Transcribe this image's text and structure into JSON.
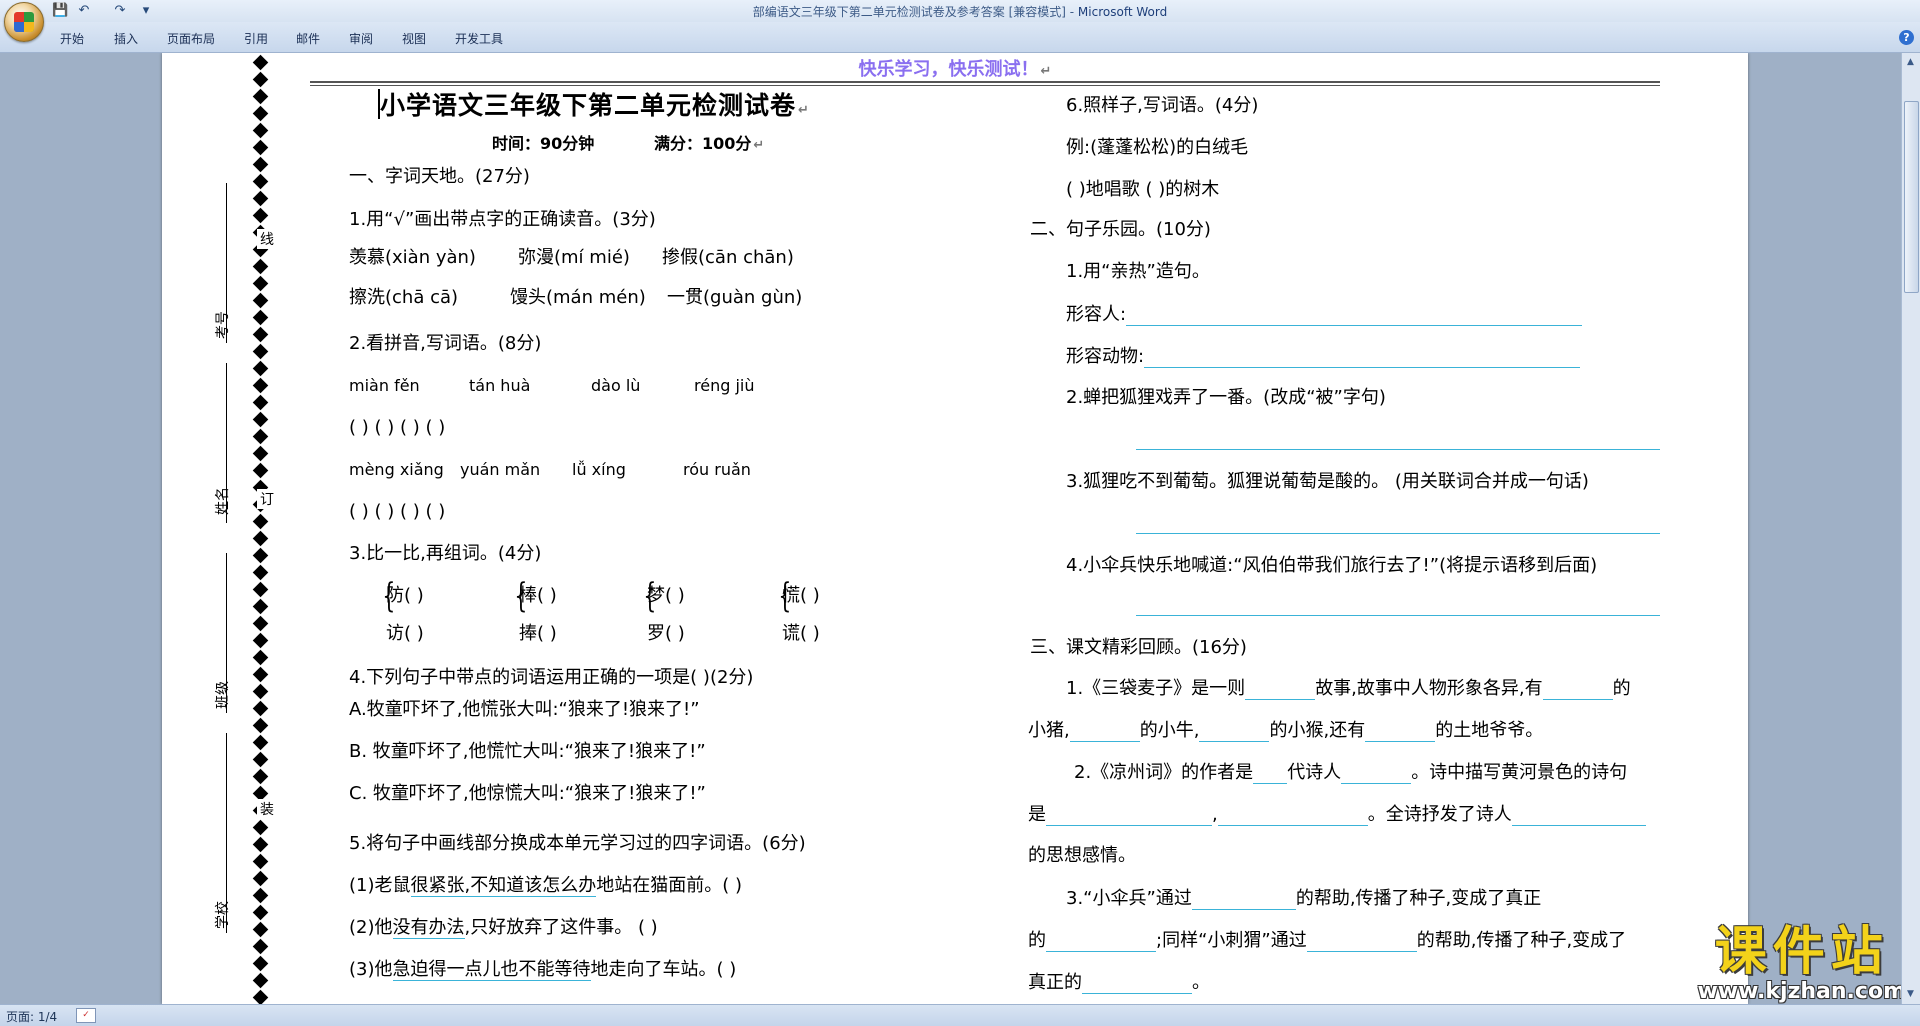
{
  "window": {
    "title_doc": "部编语文三年级下第二单元检测试卷及参考答案 [兼容模式] - ",
    "title_app": "Microsoft Word"
  },
  "ribbon": {
    "tabs": [
      "开始",
      "插入",
      "页面布局",
      "引用",
      "邮件",
      "审阅",
      "视图",
      "开发工具"
    ]
  },
  "status": {
    "page": "页面: 1/4"
  },
  "doc": {
    "header": "快乐学习，快乐测试！",
    "title": "小学语文三年级下第二单元检测试卷",
    "time": "时间：90分钟",
    "score": "满分：100分",
    "sidebar": {
      "kaohao": "考号",
      "xingming": "姓名",
      "banji": "班级",
      "xuexiao": "学校",
      "xian": "线",
      "ding": "订",
      "zhuang": "装"
    },
    "left": {
      "s1": "一、字词天地。(27分)",
      "q1": "1.用“√”画出带点字的正确读音。(3分)",
      "q1_a1": "羡慕(xiàn  yàn)",
      "q1_a2": "弥漫(mí  mié)",
      "q1_a3": "掺假(cān  chān)",
      "q1_b1": "擦洗(chā  cā)",
      "q1_b2": "馒头(mán  mén)",
      "q1_b3": "一贯(guàn  gùn)",
      "q2": "2.看拼音,写词语。(8分)",
      "q2_p1": "miàn fěn",
      "q2_p2": "tán huà",
      "q2_p3": "dào lù",
      "q2_p4": "réng  jiù",
      "q2_p5": "mèng xiǎng",
      "q2_p6": "yuán mǎn",
      "q2_p7": "lǚ  xíng",
      "q2_p8": "róu ruǎn",
      "paren_row": "(           )    (           )    (           )    (           )",
      "paren_row2": "(           )    (           )    (           )   (           )",
      "q3": "3.比一比,再组词。(4分)",
      "q3_w": [
        "防(      )",
        "访(      )",
        "棒(      )",
        "捧(      )",
        "梦(      )",
        "罗(      )",
        "慌(      )",
        "谎(      )"
      ],
      "q4": "4.下列句子中带点的词语运用正确的一项是(      )(2分)",
      "q4_a": "A.牧童吓坏了,他慌张大叫:“狼来了!狼来了!”",
      "q4_b": "B. 牧童吓坏了,他慌忙大叫:“狼来了!狼来了!”",
      "q4_c": "C. 牧童吓坏了,他惊慌大叫:“狼来了!狼来了!”",
      "q5": "5.将句子中画线部分换成本单元学习过的四字词语。(6分)",
      "q5_1a": "(1)老鼠",
      "q5_1u": "很紧张,不知道该怎么办",
      "q5_1b": "地站在猫面前。(                  )",
      "q5_2a": "(2)他",
      "q5_2u": "没有办法",
      "q5_2b": ",只好放弃了这件事。 (                 )",
      "q5_3a": "(3)他",
      "q5_3u": "急迫得一点儿也不能等待",
      "q5_3b": "地走向了车站。(                  )"
    },
    "right": {
      "q6": "6.照样子,写词语。(4分)",
      "q6_ex": "例:(蓬蓬松松)的白绒毛",
      "q6_a": "(             )地唱歌    (             )的树木",
      "s2": "二、句子乐园。(10分)",
      "r1": "1.用“亲热”造句。",
      "r1_a": "形容人:",
      "r1_b": "形容动物:",
      "r2": "2.蝉把狐狸戏弄了一番。(改成“被”字句)",
      "r3": "3.狐狸吃不到葡萄。狐狸说葡萄是酸的。   (用关联词合并成一句话)",
      "r4": "4.小伞兵快乐地喊道:“风伯伯带我们旅行去了!”(将提示语移到后面)",
      "s3": "三、课文精彩回顾。(16分)",
      "k1_a": "1.《三袋麦子》是一则",
      "k1_b": "故事,故事中人物形象各异,有",
      "k1_c": "的",
      "k1_d": "小猪,",
      "k1_e": "的小牛,",
      "k1_f": "的小猴,还有",
      "k1_g": "的土地爷爷。",
      "k2_a": "2.《凉州词》的作者是",
      "k2_b": "代诗人",
      "k2_c": "。诗中描写黄河景色的诗句",
      "k2_d": "是",
      "k2_e": ",",
      "k2_f": "。全诗抒发了诗人",
      "k2_g": "的思想感情。",
      "k3_a": "3.“小伞兵”通过",
      "k3_b": "的帮助,传播了种子,变成了真正",
      "k3_c": "的",
      "k3_d": ";同样“小刺猬”通过",
      "k3_e": "的帮助,传播了种子,变成了",
      "k3_f": "真正的",
      "k3_g": "。"
    },
    "watermark": {
      "text": "课件站",
      "url": "www.kjzhan.com"
    }
  }
}
